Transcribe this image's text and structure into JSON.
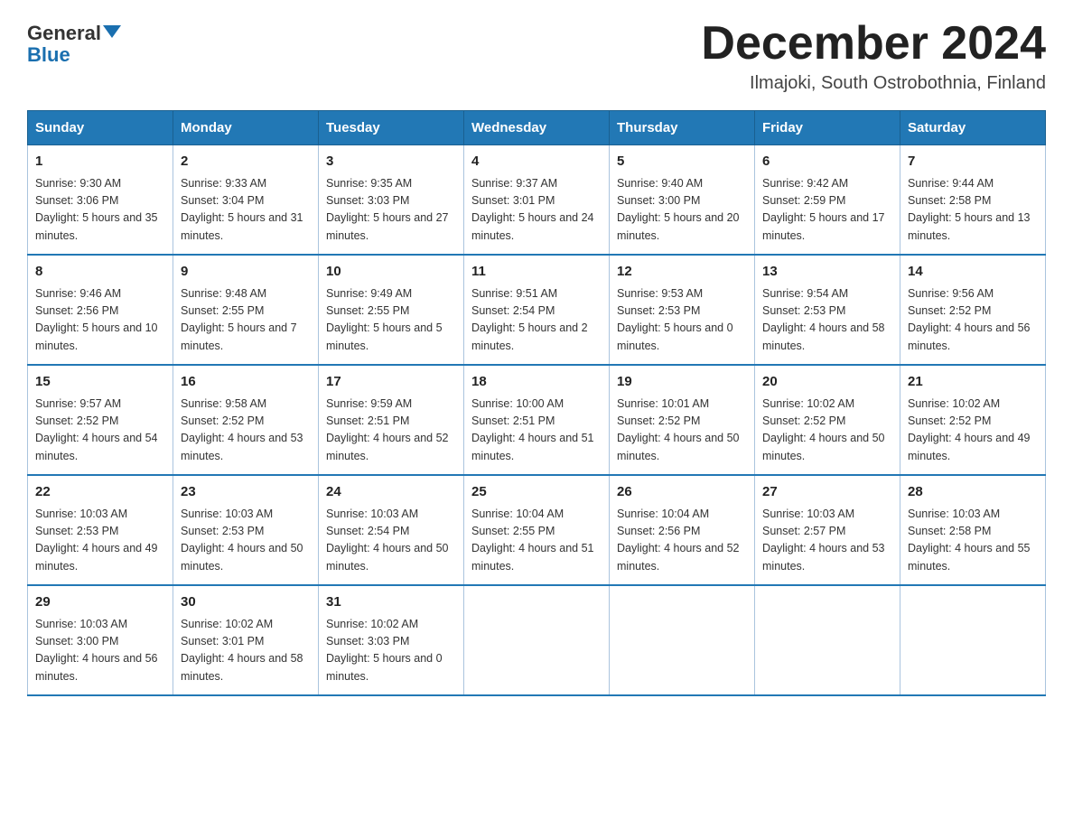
{
  "header": {
    "logo_general": "General",
    "logo_blue": "Blue",
    "title": "December 2024",
    "location": "Ilmajoki, South Ostrobothnia, Finland"
  },
  "weekdays": [
    "Sunday",
    "Monday",
    "Tuesday",
    "Wednesday",
    "Thursday",
    "Friday",
    "Saturday"
  ],
  "weeks": [
    [
      {
        "day": "1",
        "sunrise": "9:30 AM",
        "sunset": "3:06 PM",
        "daylight": "5 hours and 35 minutes."
      },
      {
        "day": "2",
        "sunrise": "9:33 AM",
        "sunset": "3:04 PM",
        "daylight": "5 hours and 31 minutes."
      },
      {
        "day": "3",
        "sunrise": "9:35 AM",
        "sunset": "3:03 PM",
        "daylight": "5 hours and 27 minutes."
      },
      {
        "day": "4",
        "sunrise": "9:37 AM",
        "sunset": "3:01 PM",
        "daylight": "5 hours and 24 minutes."
      },
      {
        "day": "5",
        "sunrise": "9:40 AM",
        "sunset": "3:00 PM",
        "daylight": "5 hours and 20 minutes."
      },
      {
        "day": "6",
        "sunrise": "9:42 AM",
        "sunset": "2:59 PM",
        "daylight": "5 hours and 17 minutes."
      },
      {
        "day": "7",
        "sunrise": "9:44 AM",
        "sunset": "2:58 PM",
        "daylight": "5 hours and 13 minutes."
      }
    ],
    [
      {
        "day": "8",
        "sunrise": "9:46 AM",
        "sunset": "2:56 PM",
        "daylight": "5 hours and 10 minutes."
      },
      {
        "day": "9",
        "sunrise": "9:48 AM",
        "sunset": "2:55 PM",
        "daylight": "5 hours and 7 minutes."
      },
      {
        "day": "10",
        "sunrise": "9:49 AM",
        "sunset": "2:55 PM",
        "daylight": "5 hours and 5 minutes."
      },
      {
        "day": "11",
        "sunrise": "9:51 AM",
        "sunset": "2:54 PM",
        "daylight": "5 hours and 2 minutes."
      },
      {
        "day": "12",
        "sunrise": "9:53 AM",
        "sunset": "2:53 PM",
        "daylight": "5 hours and 0 minutes."
      },
      {
        "day": "13",
        "sunrise": "9:54 AM",
        "sunset": "2:53 PM",
        "daylight": "4 hours and 58 minutes."
      },
      {
        "day": "14",
        "sunrise": "9:56 AM",
        "sunset": "2:52 PM",
        "daylight": "4 hours and 56 minutes."
      }
    ],
    [
      {
        "day": "15",
        "sunrise": "9:57 AM",
        "sunset": "2:52 PM",
        "daylight": "4 hours and 54 minutes."
      },
      {
        "day": "16",
        "sunrise": "9:58 AM",
        "sunset": "2:52 PM",
        "daylight": "4 hours and 53 minutes."
      },
      {
        "day": "17",
        "sunrise": "9:59 AM",
        "sunset": "2:51 PM",
        "daylight": "4 hours and 52 minutes."
      },
      {
        "day": "18",
        "sunrise": "10:00 AM",
        "sunset": "2:51 PM",
        "daylight": "4 hours and 51 minutes."
      },
      {
        "day": "19",
        "sunrise": "10:01 AM",
        "sunset": "2:52 PM",
        "daylight": "4 hours and 50 minutes."
      },
      {
        "day": "20",
        "sunrise": "10:02 AM",
        "sunset": "2:52 PM",
        "daylight": "4 hours and 50 minutes."
      },
      {
        "day": "21",
        "sunrise": "10:02 AM",
        "sunset": "2:52 PM",
        "daylight": "4 hours and 49 minutes."
      }
    ],
    [
      {
        "day": "22",
        "sunrise": "10:03 AM",
        "sunset": "2:53 PM",
        "daylight": "4 hours and 49 minutes."
      },
      {
        "day": "23",
        "sunrise": "10:03 AM",
        "sunset": "2:53 PM",
        "daylight": "4 hours and 50 minutes."
      },
      {
        "day": "24",
        "sunrise": "10:03 AM",
        "sunset": "2:54 PM",
        "daylight": "4 hours and 50 minutes."
      },
      {
        "day": "25",
        "sunrise": "10:04 AM",
        "sunset": "2:55 PM",
        "daylight": "4 hours and 51 minutes."
      },
      {
        "day": "26",
        "sunrise": "10:04 AM",
        "sunset": "2:56 PM",
        "daylight": "4 hours and 52 minutes."
      },
      {
        "day": "27",
        "sunrise": "10:03 AM",
        "sunset": "2:57 PM",
        "daylight": "4 hours and 53 minutes."
      },
      {
        "day": "28",
        "sunrise": "10:03 AM",
        "sunset": "2:58 PM",
        "daylight": "4 hours and 55 minutes."
      }
    ],
    [
      {
        "day": "29",
        "sunrise": "10:03 AM",
        "sunset": "3:00 PM",
        "daylight": "4 hours and 56 minutes."
      },
      {
        "day": "30",
        "sunrise": "10:02 AM",
        "sunset": "3:01 PM",
        "daylight": "4 hours and 58 minutes."
      },
      {
        "day": "31",
        "sunrise": "10:02 AM",
        "sunset": "3:03 PM",
        "daylight": "5 hours and 0 minutes."
      },
      null,
      null,
      null,
      null
    ]
  ]
}
